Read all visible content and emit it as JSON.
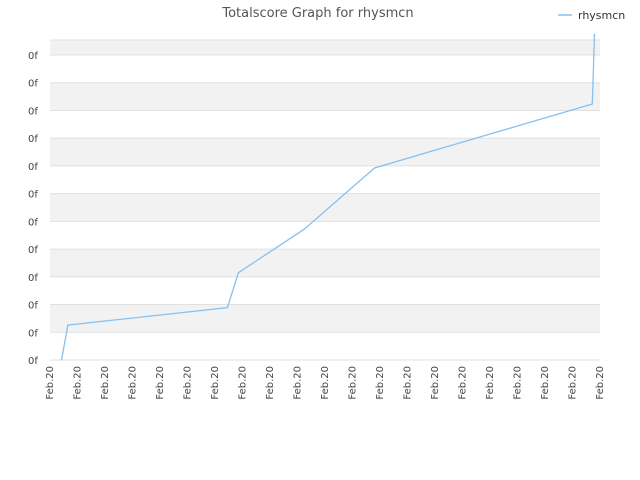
{
  "chart_data": {
    "type": "line",
    "title": "Totalscore Graph for rhysmcn",
    "xlabel": "",
    "ylabel": "",
    "legend_position": "top-right",
    "grid": true,
    "band_colors": [
      "#f2f2f2",
      "#ffffff"
    ],
    "y_tick_labels": [
      "0f",
      "0f",
      "0f",
      "0f",
      "0f",
      "0f",
      "0f",
      "0f",
      "0f",
      "0f",
      "0f",
      "0f"
    ],
    "x_tick_labels": [
      "Feb.20",
      "Feb.20",
      "Feb.20",
      "Feb.20",
      "Feb.20",
      "Feb.20",
      "Feb.20",
      "Feb.20",
      "Feb.20",
      "Feb.20",
      "Feb.20",
      "Feb.20",
      "Feb.20",
      "Feb.20",
      "Feb.20",
      "Feb.20",
      "Feb.20",
      "Feb.20",
      "Feb.20",
      "Feb.20",
      "Feb.20"
    ],
    "xlim": [
      0,
      20
    ],
    "ylim": [
      0,
      11
    ],
    "series": [
      {
        "name": "rhysmcn",
        "color": "#88c0ee",
        "x": [
          0.42,
          0.65,
          6.45,
          6.85,
          9.25,
          11.8,
          19.72,
          19.8
        ],
        "y": [
          0.0,
          1.2,
          1.8,
          3.0,
          4.5,
          6.6,
          8.8,
          11.2
        ]
      }
    ]
  }
}
